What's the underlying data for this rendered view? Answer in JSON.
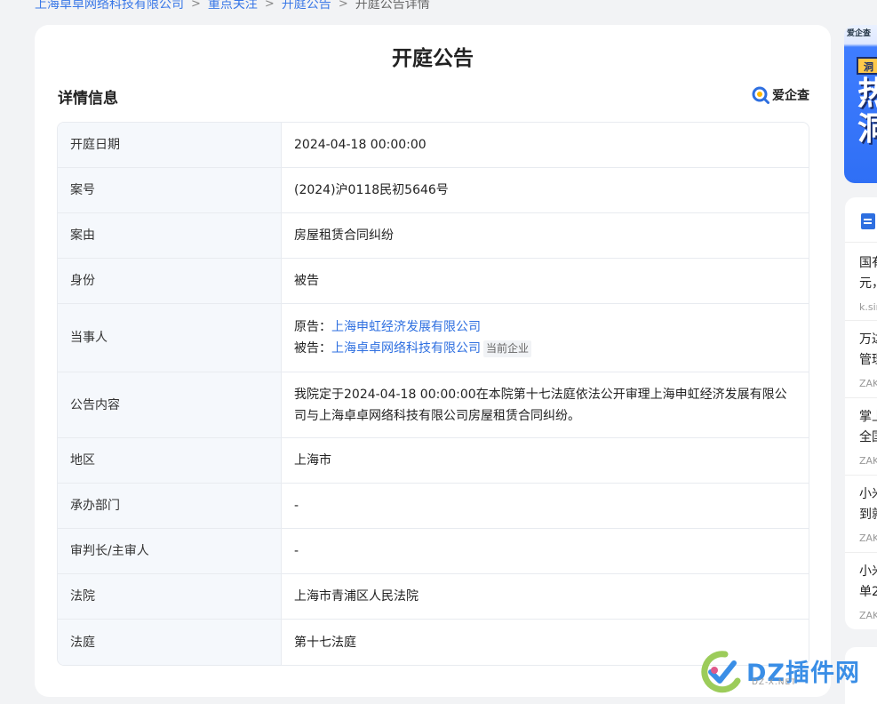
{
  "breadcrumb": {
    "items": [
      "上海卓卓网络科技有限公司",
      "重点关注",
      "开庭公告"
    ],
    "current": "开庭公告详情",
    "separator": ">"
  },
  "page_title": "开庭公告",
  "section_title": "详情信息",
  "brand_name": "爱企查",
  "details": {
    "rows": [
      {
        "label": "开庭日期",
        "value": "2024-04-18 00:00:00"
      },
      {
        "label": "案号",
        "value": "(2024)沪0118民初5646号"
      },
      {
        "label": "案由",
        "value": "房屋租赁合同纠纷"
      },
      {
        "label": "身份",
        "value": "被告"
      },
      {
        "label": "当事人"
      },
      {
        "label": "公告内容",
        "value": "我院定于2024-04-18 00:00:00在本院第十七法庭依法公开审理上海申虹经济发展有限公司与上海卓卓网络科技有限公司房屋租赁合同纠纷。"
      },
      {
        "label": "地区",
        "value": "上海市"
      },
      {
        "label": "承办部门",
        "value": "-"
      },
      {
        "label": "审判长/主审人",
        "value": "-"
      },
      {
        "label": "法院",
        "value": "上海市青浦区人民法院"
      },
      {
        "label": "法庭",
        "value": "第十七法庭"
      }
    ],
    "parties": {
      "plaintiff_label": "原告：",
      "plaintiff_name": "上海申虹经济发展有限公司",
      "defendant_label": "被告：",
      "defendant_name": "上海卓卓网络科技有限公司",
      "current_tag": "当前企业"
    }
  },
  "sidebar": {
    "ad": {
      "top_text": "爱企查",
      "tag": "洞",
      "big_text": "热\n洞"
    },
    "news": [
      {
        "title": "国有\n元，",
        "source": "k.sin"
      },
      {
        "title": "万达\n管理",
        "source": "ZAK"
      },
      {
        "title": "掌上\n全国",
        "source": "ZAK"
      },
      {
        "title": "小米\n到就",
        "source": "ZAK"
      },
      {
        "title": "小米\n单2",
        "source": "ZAK"
      }
    ]
  },
  "watermark": {
    "text": "DZ插件网",
    "sub": "DZ-X.NET"
  },
  "colors": {
    "link": "#2e6fe0",
    "label_bg": "#f5f8fc",
    "page_bg": "#f2f3f5"
  }
}
